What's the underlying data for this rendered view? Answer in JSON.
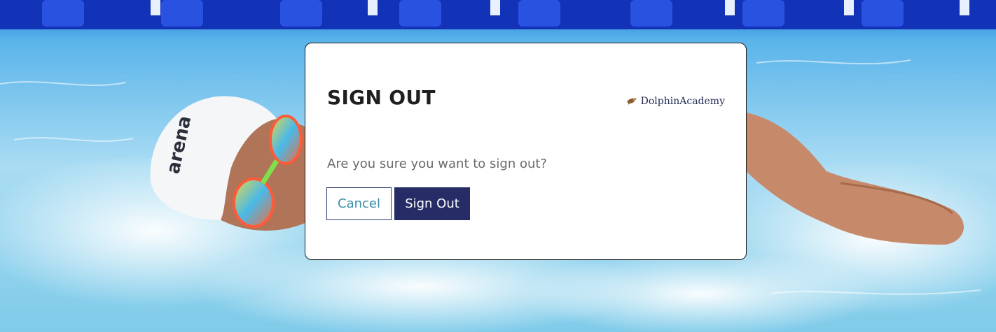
{
  "background": {
    "description_icon": "swimmer-photo",
    "cap_text": "arena"
  },
  "dialog": {
    "title": "SIGN OUT",
    "brand": {
      "name": "DolphinAcademy",
      "icon": "dolphin-logo-icon"
    },
    "message": "Are you sure you want to sign out?",
    "cancel_label": "Cancel",
    "confirm_label": "Sign Out"
  },
  "colors": {
    "primary_button": "#262d66",
    "cancel_text": "#3a8ea5",
    "title": "#1f1f1f",
    "message": "#6a6a6a",
    "brand": "#222a54",
    "pool_water": "#8fd3ee"
  }
}
